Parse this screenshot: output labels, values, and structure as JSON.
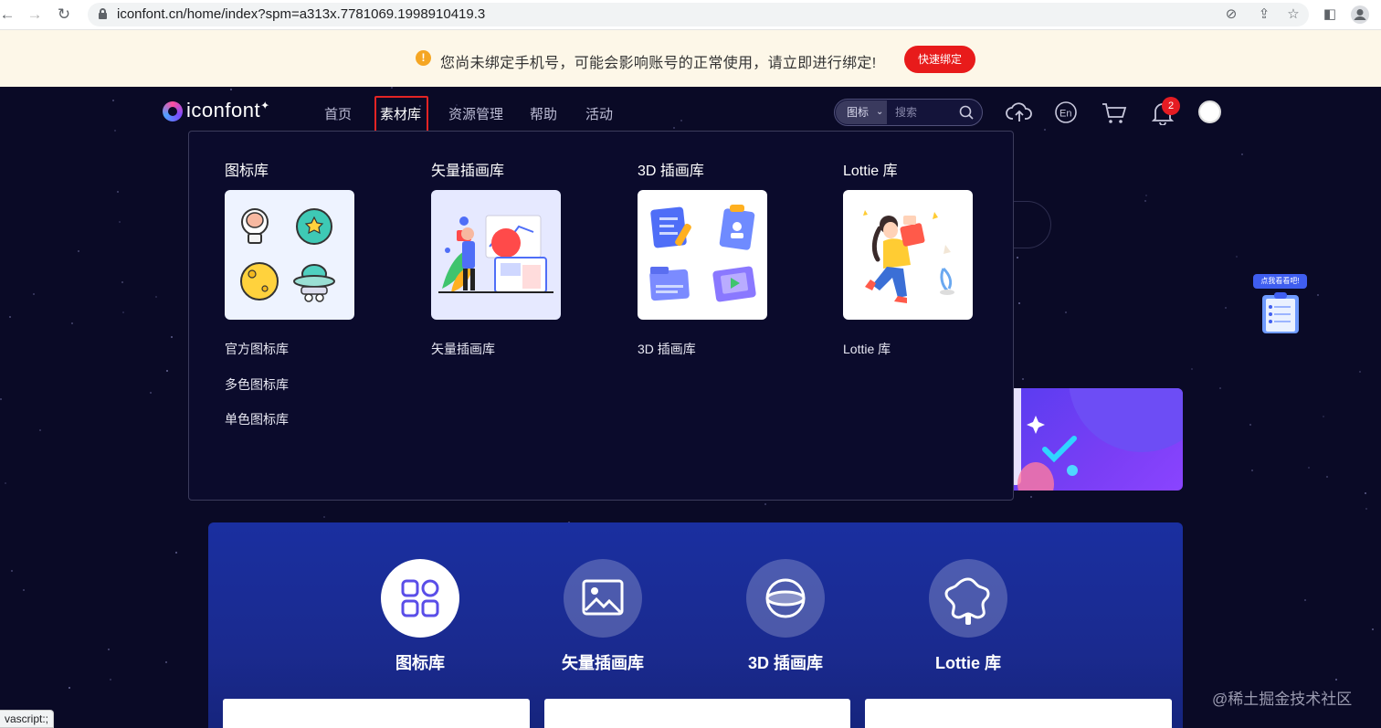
{
  "browser": {
    "url": "iconfont.cn/home/index?spm=a313x.7781069.1998910419.3",
    "status_text": "vascript:;"
  },
  "notice": {
    "text": "您尚未绑定手机号，可能会影响账号的正常使用，请立即进行绑定!",
    "button_label": "快速绑定"
  },
  "header": {
    "logo_text": "iconfont",
    "nav": [
      {
        "label": "首页"
      },
      {
        "label": "素材库"
      },
      {
        "label": "资源管理"
      },
      {
        "label": "帮助"
      },
      {
        "label": "活动"
      }
    ],
    "search": {
      "type_label": "图标",
      "placeholder": "搜索"
    },
    "notification_count": "2"
  },
  "menu": {
    "columns": [
      {
        "title": "图标库",
        "links": [
          "官方图标库",
          "多色图标库",
          "单色图标库"
        ]
      },
      {
        "title": "矢量插画库",
        "links": [
          "矢量插画库"
        ]
      },
      {
        "title": "3D 插画库",
        "links": [
          "3D 插画库"
        ]
      },
      {
        "title": "Lottie 库",
        "links": [
          "Lottie 库"
        ]
      }
    ]
  },
  "helper": {
    "label": "点我看看吧!"
  },
  "categories": [
    {
      "label": "图标库"
    },
    {
      "label": "矢量插画库"
    },
    {
      "label": "3D 插画库"
    },
    {
      "label": "Lottie 库"
    }
  ],
  "watermark": "@稀土掘金技术社区",
  "colors": {
    "notice_button": "#e81b1b",
    "nav_highlight": "#e32424",
    "panel": "#1a2fa0",
    "badge": "#e51c23"
  }
}
